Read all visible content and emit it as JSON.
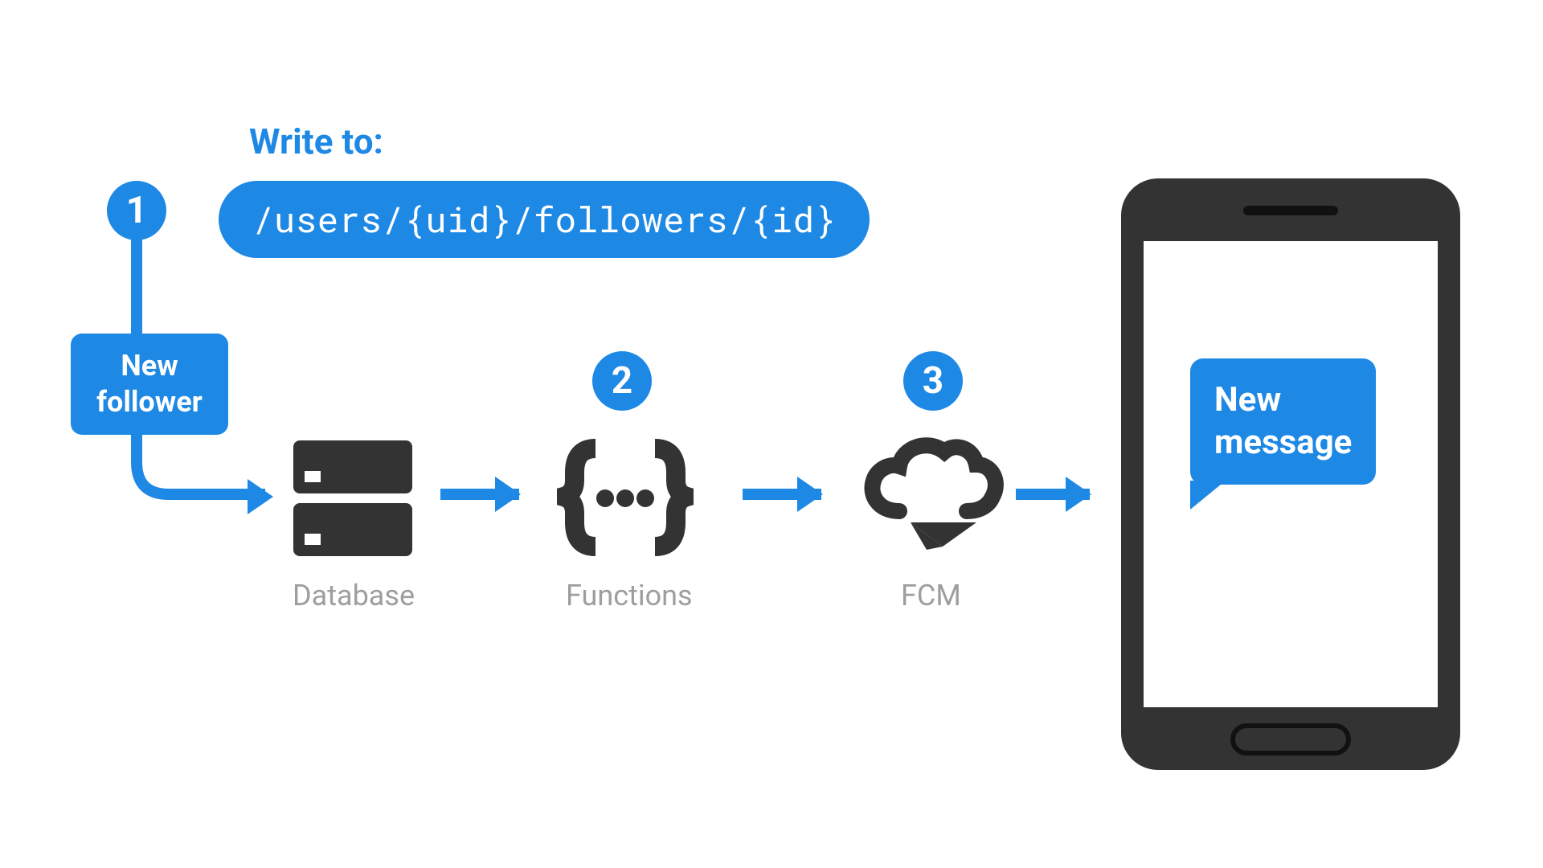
{
  "header": {
    "write_label": "Write to:",
    "path": "/users/{uid}/followers/{id}"
  },
  "steps": {
    "s1": "1",
    "s2": "2",
    "s3": "3"
  },
  "trigger": {
    "label_line1": "New",
    "label_line2": "follower"
  },
  "services": {
    "database": "Database",
    "functions": "Functions",
    "fcm": "FCM"
  },
  "phone": {
    "notification_line1": "New",
    "notification_line2": "message"
  },
  "colors": {
    "accent": "#1e88e5",
    "icon": "#333333",
    "muted": "#9e9e9e"
  }
}
